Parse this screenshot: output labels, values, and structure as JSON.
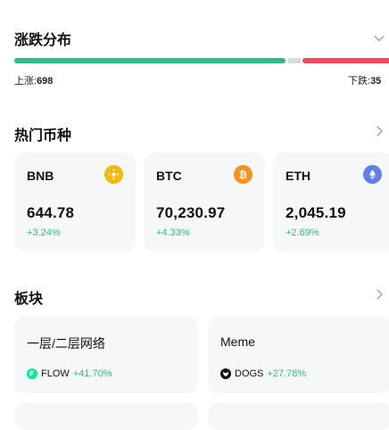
{
  "breadth": {
    "title": "涨跌分布",
    "up_label": "上涨:",
    "up_count": "698",
    "down_label": "下跌:",
    "down_count": "35",
    "colors": {
      "up": "#2ebd85",
      "flat": "#d9d9d9",
      "down": "#f6465d"
    }
  },
  "hot_coins": {
    "title": "热门币种",
    "items": [
      {
        "symbol": "BNB",
        "price": "644.78",
        "change": "+3.24%",
        "icon": "bnb-icon",
        "color": "#f0b90b"
      },
      {
        "symbol": "BTC",
        "price": "70,230.97",
        "change": "+4.33%",
        "icon": "btc-icon",
        "color": "#f7931a"
      },
      {
        "symbol": "ETH",
        "price": "2,045.19",
        "change": "+2.69%",
        "icon": "eth-icon",
        "color": "#627eea"
      }
    ]
  },
  "sectors": {
    "title": "板块",
    "items": [
      {
        "name": "一层/二层网络",
        "token": "FLOW",
        "change": "+41.70%",
        "icon": "flow-icon"
      },
      {
        "name": "Meme",
        "token": "DOGS",
        "change": "+27.78%",
        "icon": "dogs-icon"
      }
    ]
  }
}
